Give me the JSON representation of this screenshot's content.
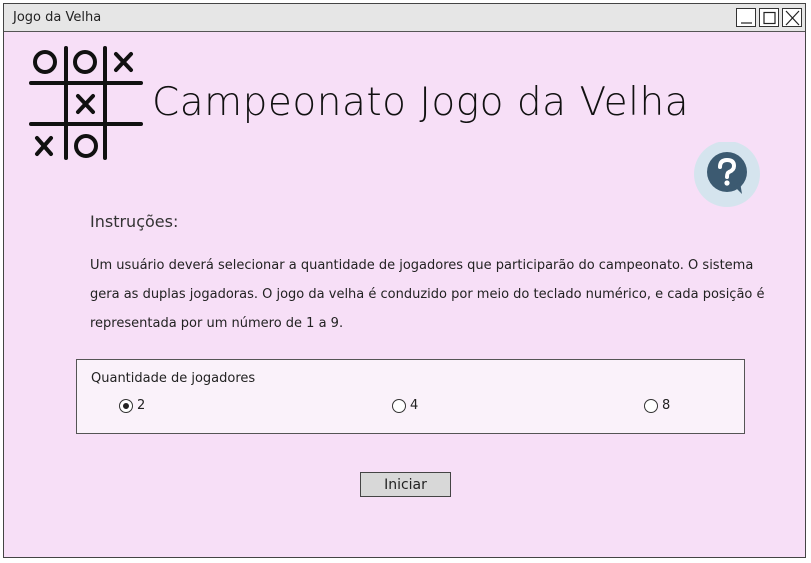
{
  "window": {
    "title": "Jogo da Velha"
  },
  "header": {
    "title": "Campeonato Jogo da Velha",
    "logo_icon": "tic-tac-toe-board-icon",
    "help_icon": "question-icon"
  },
  "instructions": {
    "heading": "Instruções:",
    "text": "Um usuário deverá selecionar a quantidade de jogadores que participarão do campeonato. O sistema gera as duplas jogadoras. O jogo da velha é conduzido por meio do teclado numérico, e cada posição é representada por um número de 1 a 9."
  },
  "players": {
    "label": "Quantidade de jogadores",
    "options": [
      {
        "label": "2",
        "checked": true
      },
      {
        "label": "4",
        "checked": false
      },
      {
        "label": "8",
        "checked": false
      }
    ]
  },
  "actions": {
    "start_label": "Iniciar"
  },
  "colors": {
    "background": "#f7dff7",
    "help_circle": "#d5e4ee",
    "help_icon": "#3c5a71"
  }
}
